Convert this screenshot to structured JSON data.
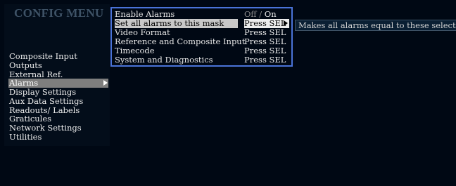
{
  "title": "CONFIG MENU",
  "left_menu": [
    {
      "label": "Composite Input"
    },
    {
      "label": "Outputs"
    },
    {
      "label": "External Ref."
    },
    {
      "label": "Alarms",
      "selected": true
    },
    {
      "label": "Display Settings"
    },
    {
      "label": "Aux Data Settings"
    },
    {
      "label": "Readouts/ Labels"
    },
    {
      "label": "Graticules"
    },
    {
      "label": "Network Settings"
    },
    {
      "label": "Utilities"
    }
  ],
  "submenu": {
    "enable_alarms": {
      "label": "Enable Alarms",
      "off": "Off",
      "sep": "/",
      "on": "On"
    },
    "rows": [
      {
        "label": "Set all alarms to this mask",
        "value": "Press SEL",
        "selected": true
      },
      {
        "label": "Video Format",
        "value": "Press SEL"
      },
      {
        "label": "Reference and Composite Input",
        "value": "Press SEL"
      },
      {
        "label": "Timecode",
        "value": "Press SEL"
      },
      {
        "label": "System and Diagnostics",
        "value": "Press SEL"
      }
    ]
  },
  "help_text": "Makes all alarms equal to these selections",
  "colors": {
    "background": "#000814",
    "menu_border": "#4a73d8",
    "selection_left": "#7e7e7e",
    "selection_sub": "#c8c8c8"
  },
  "icons": {
    "submenu_arrow": "triangle-right-icon"
  }
}
